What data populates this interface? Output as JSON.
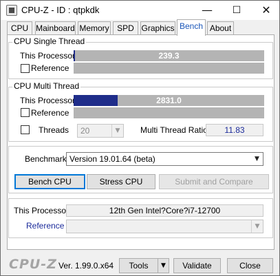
{
  "window": {
    "title": "CPU-Z - ID : qtpkdk",
    "minimize_glyph": "—",
    "maximize_glyph": "☐",
    "close_glyph": "✕"
  },
  "tabs": [
    {
      "label": "CPU"
    },
    {
      "label": "Mainboard"
    },
    {
      "label": "Memory"
    },
    {
      "label": "SPD"
    },
    {
      "label": "Graphics"
    },
    {
      "label": "Bench",
      "active": true
    },
    {
      "label": "About"
    }
  ],
  "single_thread": {
    "legend": "CPU Single Thread",
    "this_processor_label": "This Processor",
    "this_processor_value": "239.3",
    "this_processor_fill_fraction": 0.008,
    "reference_label": "Reference"
  },
  "multi_thread": {
    "legend": "CPU Multi Thread",
    "this_processor_label": "This Processor",
    "this_processor_value": "2831.0",
    "this_processor_fill_fraction": 0.23,
    "reference_label": "Reference",
    "threads_label": "Threads",
    "threads_value": "20",
    "ratio_label": "Multi Thread Ratio",
    "ratio_value": "11.83"
  },
  "benchmark": {
    "label": "Benchmark",
    "version_value": "Version 19.01.64 (beta)",
    "bench_cpu_label": "Bench CPU",
    "stress_cpu_label": "Stress CPU",
    "submit_label": "Submit and Compare"
  },
  "compare": {
    "this_processor_label": "This Processor",
    "this_processor_value": "12th Gen Intel?Core?i7-12700",
    "reference_label": "Reference",
    "reference_value": ""
  },
  "footer": {
    "logo": "CPU-Z",
    "version": "Ver. 1.99.0.x64",
    "tools_label": "Tools",
    "validate_label": "Validate",
    "close_label": "Close"
  },
  "colors": {
    "bar_fill": "#1f2d8a",
    "bar_bg": "#b4b4b4",
    "active_tab_text": "#1a56b8",
    "reference_link": "#1a2a9a"
  }
}
